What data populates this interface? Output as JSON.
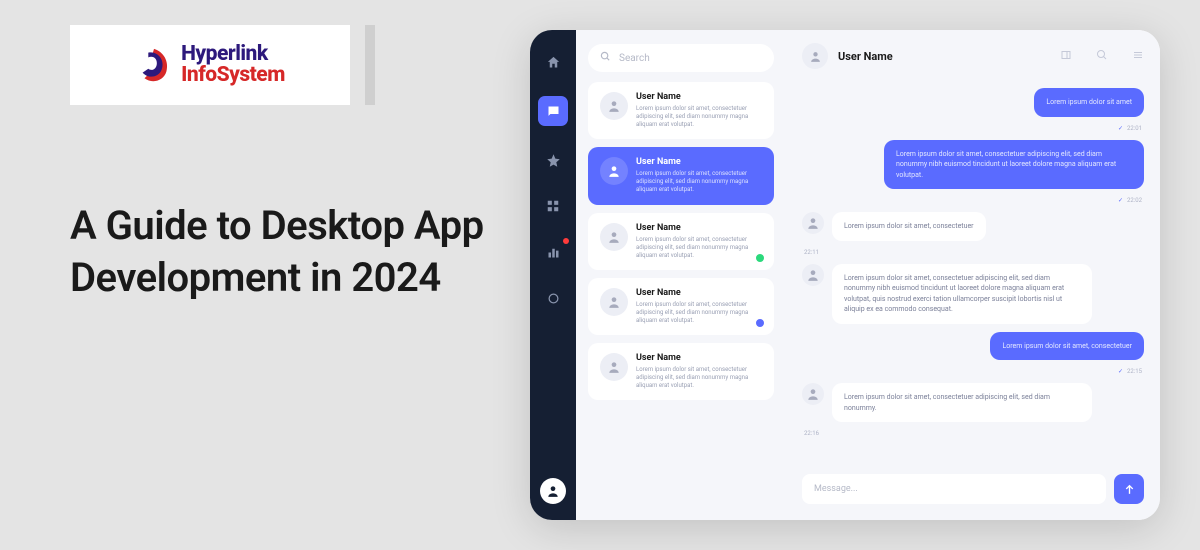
{
  "logo": {
    "line1": "Hyperlink",
    "line2": "InfoSystem"
  },
  "headline": "A Guide to Desktop App Development in 2024",
  "app": {
    "search_placeholder": "Search",
    "header": {
      "user": "User Name"
    },
    "rail": [
      "home",
      "chat",
      "star",
      "apps",
      "stats",
      "settings"
    ],
    "contacts": [
      {
        "name": "User Name",
        "preview": "Lorem ipsum dolor sit amet, consectetuer adipiscing elit, sed diam nonummy magna aliquam erat volutpat.",
        "active": false,
        "badge": null
      },
      {
        "name": "User Name",
        "preview": "Lorem ipsum dolor sit amet, consectetuer adipiscing elit, sed diam nonummy magna aliquam erat volutpat.",
        "active": true,
        "badge": null
      },
      {
        "name": "User Name",
        "preview": "Lorem ipsum dolor sit amet, consectetuer adipiscing elit, sed diam nonummy magna aliquam erat volutpat.",
        "active": false,
        "badge": "green"
      },
      {
        "name": "User Name",
        "preview": "Lorem ipsum dolor sit amet, consectetuer adipiscing elit, sed diam nonummy magna aliquam erat volutpat.",
        "active": false,
        "badge": "blue"
      },
      {
        "name": "User Name",
        "preview": "Lorem ipsum dolor sit amet, consectetuer adipiscing elit, sed diam nonummy magna aliquam erat volutpat.",
        "active": false,
        "badge": null
      }
    ],
    "messages": [
      {
        "side": "right",
        "style": "primary",
        "text": "Lorem ipsum dolor sit amet",
        "time": "22:01"
      },
      {
        "side": "right",
        "style": "primary",
        "text": "Lorem ipsum dolor sit amet, consectetuer adipiscing elit, sed diam nonummy nibh euismod tincidunt ut laoreet dolore magna aliquam erat volutpat.",
        "time": "22:02"
      },
      {
        "side": "left",
        "style": "white",
        "text": "Lorem ipsum dolor sit amet, consectetuer",
        "time": "22:11"
      },
      {
        "side": "left",
        "style": "white",
        "text": "Lorem ipsum dolor sit amet, consectetuer adipiscing elit, sed diam nonummy nibh euismod tincidunt ut laoreet dolore magna aliquam erat volutpat, quis nostrud exerci tation ullamcorper suscipit lobortis nisl ut aliquip ex ea commodo consequat.",
        "time": ""
      },
      {
        "side": "right",
        "style": "primary",
        "text": "Lorem ipsum dolor sit amet, consectetuer",
        "time": "22:15"
      },
      {
        "side": "left",
        "style": "white",
        "text": "Lorem ipsum dolor sit amet, consectetuer adipiscing elit, sed diam nonummy.",
        "time": "22:16"
      }
    ],
    "composer_placeholder": "Message..."
  }
}
